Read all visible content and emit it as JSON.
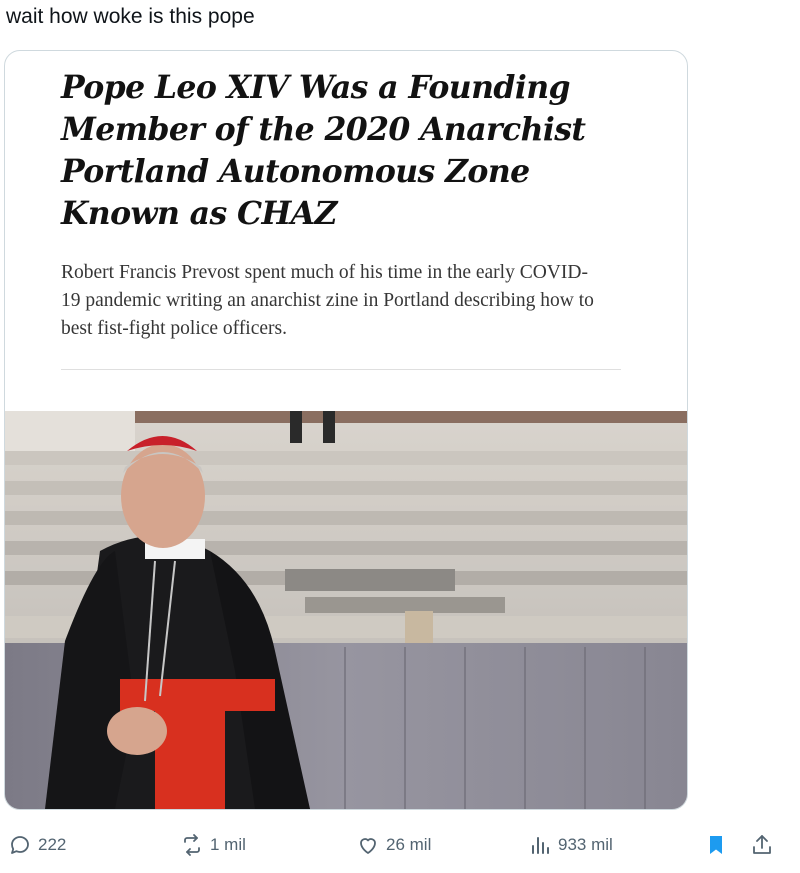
{
  "tweet": {
    "text": "wait how woke is this pope"
  },
  "article": {
    "headline": "Pope Leo XIV Was a Founding Member of the 2020 Anarchist Portland Autonomous Zone Known as CHAZ",
    "summary": "Robert Francis Prevost spent much of his time in the early COVID-19 pandemic writing an anarchist zine in Portland describing how to best fist-fight police officers."
  },
  "actions": {
    "replies": "222",
    "reposts": "1 mil",
    "likes": "26 mil",
    "views": "933 mil"
  },
  "icons": {
    "reply": "reply-icon",
    "repost": "repost-icon",
    "like": "heart-icon",
    "views": "views-icon",
    "bookmark": "bookmark-icon",
    "share": "share-icon"
  },
  "colors": {
    "bookmark_active": "#1d9bf0",
    "action_gray": "#536471"
  }
}
